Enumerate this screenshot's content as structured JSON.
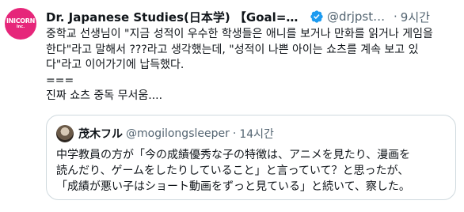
{
  "tweet": {
    "avatar_text_top": "INICORN",
    "avatar_text_bottom": "Inc.",
    "display_name": "Dr. Japanese Studies(日本学) 【Goal=Writing …",
    "handle": "@drjpstu…",
    "separator": "·",
    "time": "9시간",
    "text": "중학교 선생님이 \"지금 성적이 우수한 학생들은 애니를 보거나 만화를 읽거나 게임을\n한다\"라고 말해서 ???라고 생각했는데, \"성적이 나쁜 아이는 쇼츠를 계속 보고 있\n다\"라고 이어가기에 납득했다.\n===\n진짜 쇼츠 중독 무서움...."
  },
  "quote": {
    "display_name": "茂木フル",
    "handle": "@mogilongsleeper",
    "separator": "·",
    "time": "14시간",
    "text": "中学教員の方が「今の成績優秀な子の特徴は、アニメを見たり、漫画を\n読んだり、ゲームをしたりしていること」と言っていて？と思ったが、\n「成績が悪い子はショート動画をずっと見ている」と続いて、察した。"
  },
  "colors": {
    "text": "#0f1419",
    "secondary": "#536471",
    "verified": "#1d9bf0",
    "avatar_bg": "#e6267a",
    "border": "#cfd9de"
  },
  "icons": {
    "verified": "verified-badge-icon"
  }
}
